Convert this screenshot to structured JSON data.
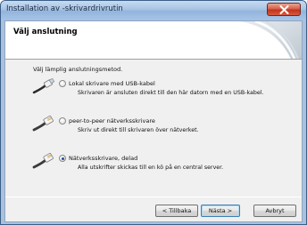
{
  "window": {
    "title": "Installation av -skrivardrivrutin"
  },
  "header": {
    "title": "Välj anslutning"
  },
  "prompt": "Välj lämplig anslutningsmetod.",
  "options": [
    {
      "label": "Lokal skrivare med USB-kabel",
      "description": "Skrivaren är ansluten direkt till den här datorn med en USB-kabel.",
      "selected": false,
      "icon": "usb-cable-icon"
    },
    {
      "label": "peer-to-peer nätverksskrivare",
      "description": "Skriv ut direkt till skrivaren över nätverket.",
      "selected": false,
      "icon": "network-cable-icon"
    },
    {
      "label": "Nätverksskrivare, delad",
      "description": "Alla utskrifter skickas till en kö på en central server.",
      "selected": true,
      "icon": "network-cable-icon"
    }
  ],
  "buttons": {
    "back": "< Tillbaka",
    "next": "Nästa >",
    "cancel": "Avbryt"
  },
  "colors": {
    "title_bar": "#a8c4e3",
    "close_button": "#c1341d",
    "dialog_background": "#f0f0f0",
    "header_background": "#ffffff",
    "radio_dot": "#1e4fa8"
  }
}
